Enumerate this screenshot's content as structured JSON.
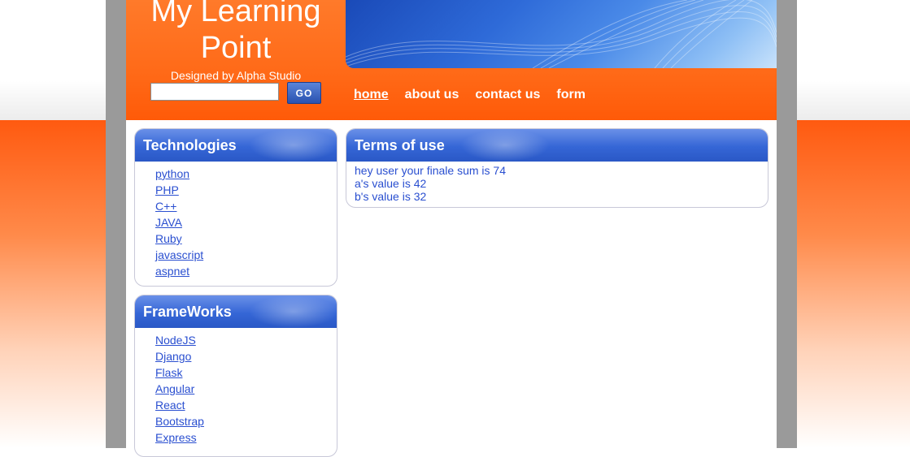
{
  "site": {
    "title": "My Learning Point",
    "designer": "Designed by Alpha Studio"
  },
  "search": {
    "value": "",
    "button_label": "GO"
  },
  "nav": [
    {
      "label": "home",
      "active": true
    },
    {
      "label": "about us",
      "active": false
    },
    {
      "label": "contact us",
      "active": false
    },
    {
      "label": "form",
      "active": false
    }
  ],
  "sidebar": {
    "technologies": {
      "heading": "Technologies",
      "items": [
        "python",
        "PHP",
        "C++",
        "JAVA",
        "Ruby",
        "javascript",
        "aspnet"
      ]
    },
    "frameworks": {
      "heading": "FrameWorks",
      "items": [
        "NodeJS",
        "Django",
        "Flask",
        "Angular",
        "React",
        "Bootstrap",
        "Express"
      ]
    }
  },
  "main": {
    "heading": "Terms of use",
    "lines": [
      "hey user your finale sum is 74",
      "a's value is 42",
      "b's value is 32"
    ]
  },
  "colors": {
    "header_orange": "#ff6a18",
    "box_blue": "#3566d6",
    "link_blue": "#2a4fd0",
    "frame_gray": "#9a9a9a"
  }
}
